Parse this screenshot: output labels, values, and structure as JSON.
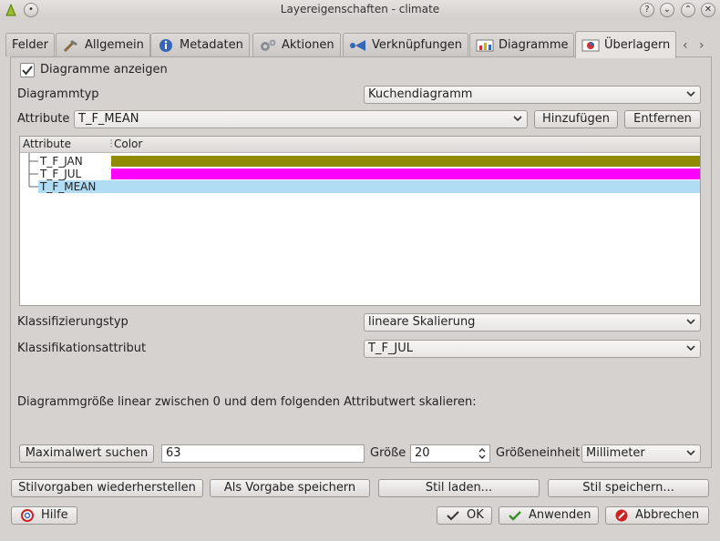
{
  "window": {
    "title": "Layereigenschaften - climate"
  },
  "tabs": [
    {
      "label": "Felder"
    },
    {
      "label": "Allgemein"
    },
    {
      "label": "Metadaten"
    },
    {
      "label": "Aktionen"
    },
    {
      "label": "Verknüpfungen"
    },
    {
      "label": "Diagramme"
    },
    {
      "label": "Überlagern"
    }
  ],
  "diagram": {
    "show_label": "Diagramme anzeigen",
    "show_checked": true,
    "type_label": "Diagrammtyp",
    "type_value": "Kuchendiagramm",
    "attribute_label": "Attribute",
    "attribute_value": "T_F_MEAN",
    "add_button": "Hinzufügen",
    "remove_button": "Entfernen"
  },
  "attribute_table": {
    "headers": [
      "Attribute",
      "Color"
    ],
    "rows": [
      {
        "name": "T_F_JAN",
        "color": "#8f8a00"
      },
      {
        "name": "T_F_JUL",
        "color": "#ff00ff"
      },
      {
        "name": "T_F_MEAN",
        "color": "#b0dcf4",
        "selected": true
      }
    ]
  },
  "classification": {
    "type_label": "Klassifizierungstyp",
    "type_value": "lineare Skalierung",
    "attr_label": "Klassifikationsattribut",
    "attr_value": "T_F_JUL"
  },
  "scaling": {
    "description": "Diagrammgröße linear zwischen 0 und dem folgenden Attributwert skalieren:",
    "find_max_button": "Maximalwert suchen",
    "max_value": "63",
    "size_label": "Größe",
    "size_value": "20",
    "unit_label": "Größeneinheit",
    "unit_value": "Millimeter"
  },
  "style_buttons": {
    "restore": "Stilvorgaben wiederherstellen",
    "save_default": "Als Vorgabe speichern",
    "load": "Stil laden...",
    "save": "Stil speichern..."
  },
  "footer": {
    "help": "Hilfe",
    "ok": "OK",
    "apply": "Anwenden",
    "cancel": "Abbrechen"
  },
  "colors": {
    "selection": "#b0dcf4",
    "accent": "#3a8e2e",
    "cancel_red": "#cc2222"
  }
}
